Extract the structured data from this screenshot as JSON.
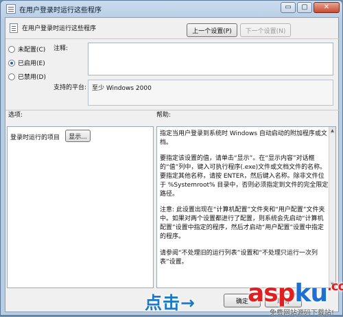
{
  "window": {
    "title": "在用户登录时运行这些程序",
    "minimize_label": "▭",
    "maximize_label": "▢",
    "close_label": "✕"
  },
  "header": {
    "title": "在用户登录时运行这些程序",
    "prev_setting_label": "上一个设置(P)",
    "next_setting_label": "下一个设置(N)"
  },
  "options": {
    "not_configured": "未配置(C)",
    "enabled": "已启用(E)",
    "disabled": "已禁用(D)",
    "selected": "enabled"
  },
  "comment": {
    "label": "注释:",
    "value": ""
  },
  "platform": {
    "label": "支持的平台:",
    "value": "至少 Windows 2000"
  },
  "sections": {
    "options_label": "选项:",
    "help_label": "帮助:"
  },
  "options_pane": {
    "item_label": "登录时运行的项目",
    "show_button": "显示..."
  },
  "help_text": [
    "指定当用户登录到系统时 Windows 自动启动的附加程序或文档。",
    "要指定该设置的值，请单击“显示”。在“显示内容”对话框的“值”列中，键入可执行程序(.exe)文件或文档文件的名称。要指定其他名称，请按 ENTER，然后键入名称。除非文件位于 %Systemroot% 目录中，否则必须指定到文件的完全限定路径。",
    "注意: 此设置出现在“计算机配置”文件夹和“用户配置”文件夹中。如果对两个设置都进行了配置，则系统会先启动“计算机配置”设置中指定的程序，然后才启动“用户配置”设置中指定的程序。",
    "请参阅“不处理旧的运行列表”设置和“不处理只运行一次列表”设置。"
  ],
  "footer": {
    "ok_label": "确定",
    "cancel_label": "取消"
  },
  "overlay": {
    "click_text": "点击→",
    "brand_asp": "asp",
    "brand_ku": "ku",
    "brand_suffix": ".com",
    "brand_sub": "免费网站源码下载站!"
  }
}
